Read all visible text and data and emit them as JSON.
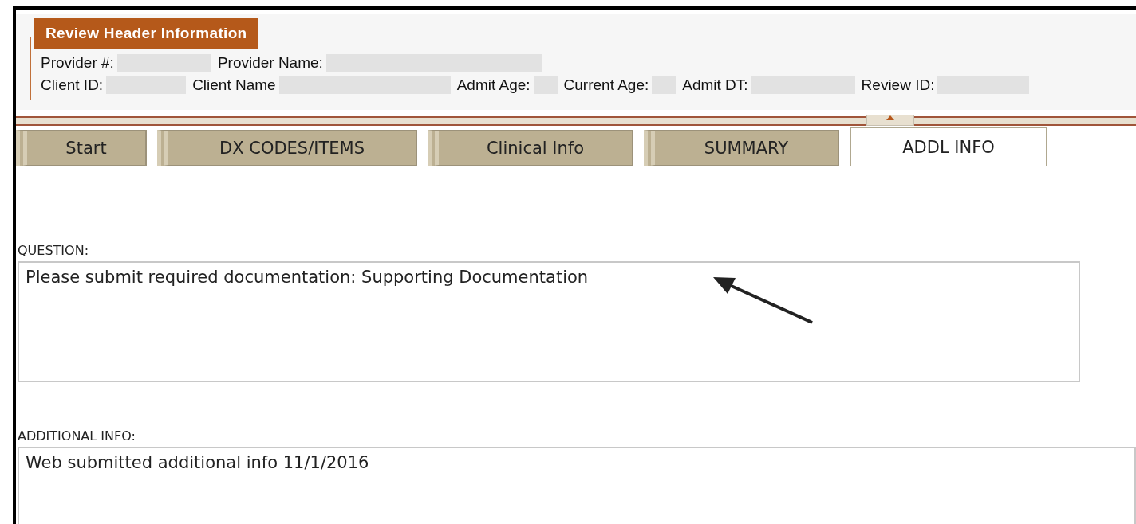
{
  "header": {
    "title": "Review Header Information",
    "rows": [
      [
        {
          "label": "Provider #:"
        },
        {
          "label": "Provider Name:"
        }
      ],
      [
        {
          "label": "Client ID:"
        },
        {
          "label": "Client Name"
        },
        {
          "label": "Admit Age:"
        },
        {
          "label": "Current Age:"
        },
        {
          "label": "Admit DT:"
        },
        {
          "label": "Review ID:"
        }
      ]
    ]
  },
  "tabs": [
    {
      "label": "Start",
      "selected": false
    },
    {
      "label": "DX CODES/ITEMS",
      "selected": false
    },
    {
      "label": "Clinical Info",
      "selected": false
    },
    {
      "label": "SUMMARY",
      "selected": false
    },
    {
      "label": "ADDL INFO",
      "selected": true
    }
  ],
  "question": {
    "label": "QUESTION:",
    "text": "Please submit required documentation: Supporting Documentation"
  },
  "additional_info": {
    "label": "ADDITIONAL INFO:",
    "text": "Web submitted additional info 11/1/2016"
  }
}
